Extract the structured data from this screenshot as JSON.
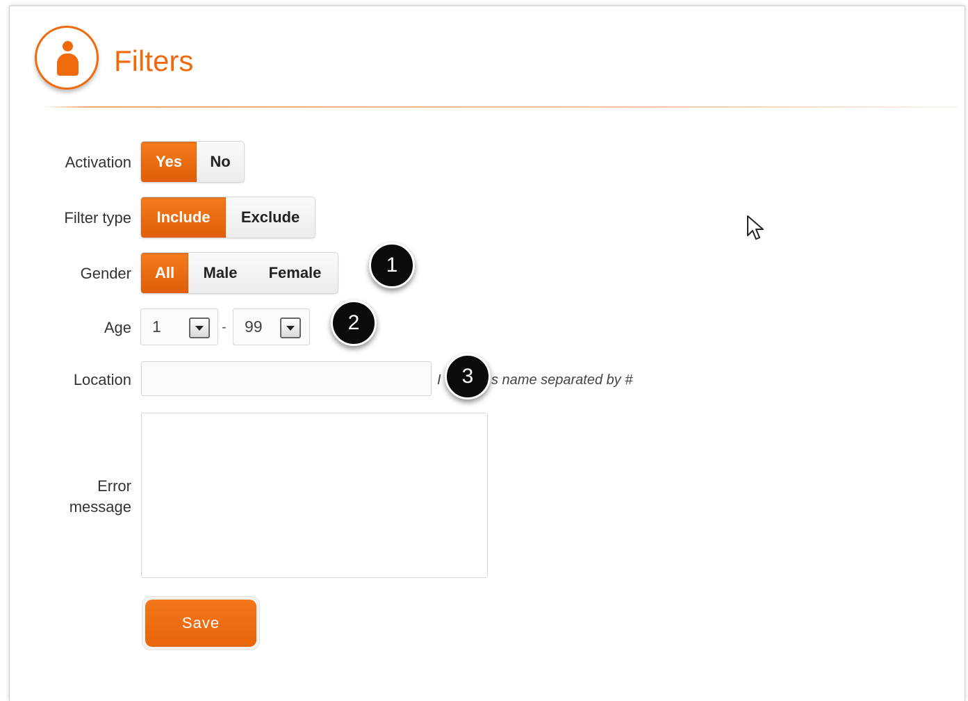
{
  "header": {
    "title": "Filters",
    "icon": "person-icon",
    "accent_color": "#ef6a0c"
  },
  "form": {
    "activation": {
      "label": "Activation",
      "options": [
        "Yes",
        "No"
      ],
      "selected": "Yes"
    },
    "filter_type": {
      "label": "Filter type",
      "options": [
        "Include",
        "Exclude"
      ],
      "selected": "Include"
    },
    "gender": {
      "label": "Gender",
      "options": [
        "All",
        "Male",
        "Female"
      ],
      "selected": "All"
    },
    "age": {
      "label": "Age",
      "min_value": "1",
      "separator": "-",
      "max_value": "99"
    },
    "location": {
      "label": "Location",
      "value": "",
      "hint_visible": "s name separated by #"
    },
    "error_message": {
      "label_line1": "Error",
      "label_line2": "message",
      "value": ""
    },
    "save_label": "Save"
  },
  "markers": [
    "1",
    "2",
    "3"
  ]
}
